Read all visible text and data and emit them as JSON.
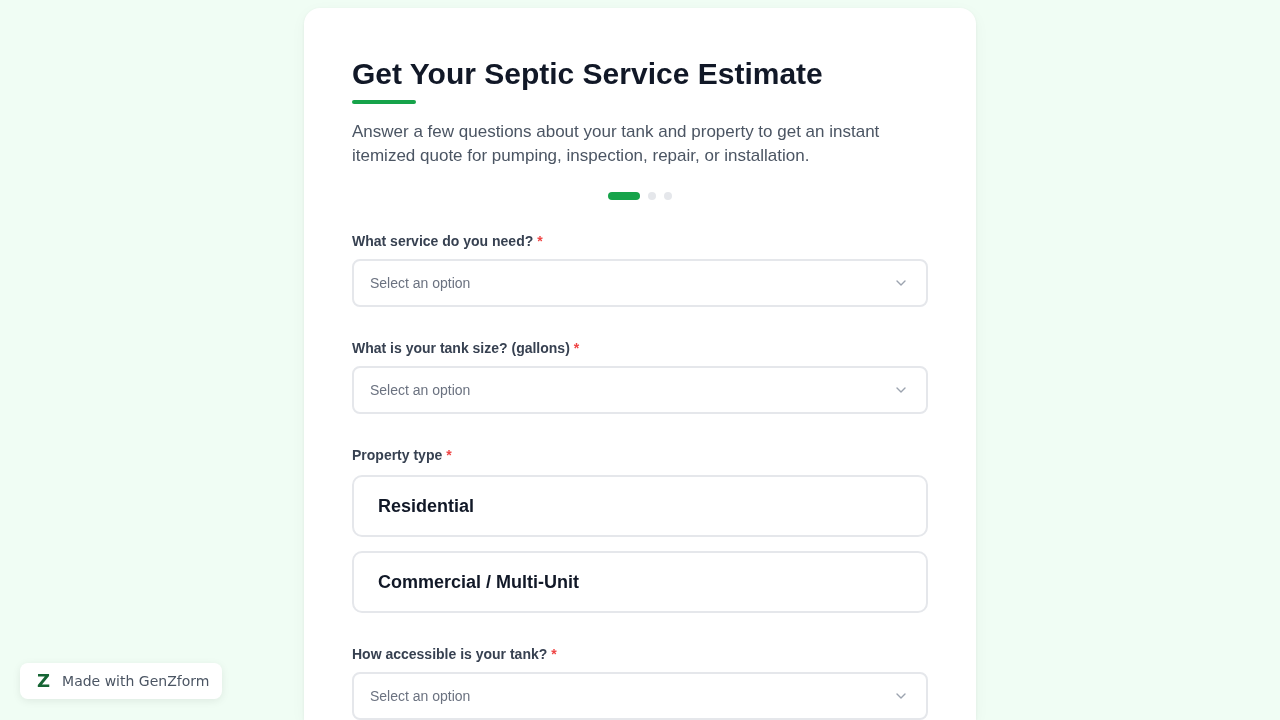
{
  "form": {
    "title": "Get Your Septic Service Estimate",
    "description": "Answer a few questions about your tank and property to get an instant itemized quote for pumping, inspection, repair, or installation.",
    "steps": [
      {
        "selected": true
      },
      {
        "selected": false
      },
      {
        "selected": false
      }
    ],
    "questions": [
      {
        "kind": "select",
        "label": "What service do you need?",
        "required_mark": "*",
        "placeholder": "Select an option"
      },
      {
        "kind": "select",
        "label": "What is your tank size? (gallons)",
        "required_mark": "*",
        "placeholder": "Select an option"
      },
      {
        "kind": "choice",
        "label": "Property type",
        "required_mark": "*",
        "options": [
          {
            "label": "Residential",
            "selected": false
          },
          {
            "label": "Commercial / Multi-Unit",
            "selected": false
          }
        ]
      },
      {
        "kind": "select",
        "label": "How accessible is your tank?",
        "required_mark": "*",
        "placeholder": "Select an option"
      }
    ]
  },
  "badge": {
    "logo": "Z",
    "text": "Made with GenZform"
  }
}
